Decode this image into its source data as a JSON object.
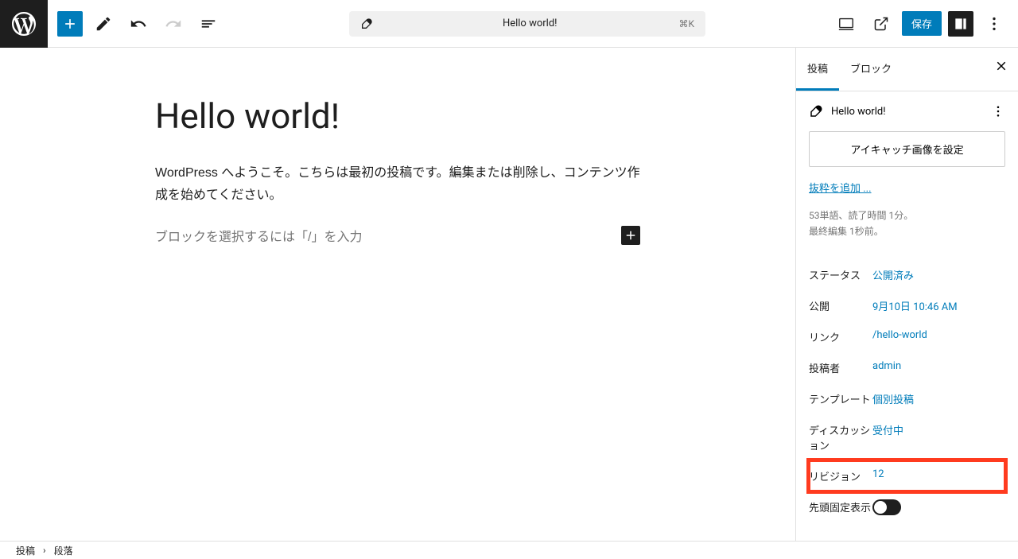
{
  "header": {
    "doc_title": "Hello world!",
    "shortcut": "⌘K",
    "save": "保存"
  },
  "editor": {
    "title": "Hello world!",
    "body": "WordPress へようこそ。こちらは最初の投稿です。編集または削除し、コンテンツ作成を始めてください。",
    "placeholder": "ブロックを選択するには「/」を入力"
  },
  "sidebar": {
    "tabs": {
      "post": "投稿",
      "block": "ブロック"
    },
    "post_name": "Hello world!",
    "featured_image": "アイキャッチ画像を設定",
    "excerpt_link": "抜粋を追加 ...",
    "stats_line1": "53単語、読了時間 1分。",
    "stats_line2": "最終編集 1秒前。",
    "meta": {
      "status_label": "ステータス",
      "status_value": "公開済み",
      "publish_label": "公開",
      "publish_value": "9月10日 10:46 AM",
      "link_label": "リンク",
      "link_value": "/hello-world",
      "author_label": "投稿者",
      "author_value": "admin",
      "template_label": "テンプレート",
      "template_value": "個別投稿",
      "discussion_label": "ディスカッション",
      "discussion_value": "受付中",
      "revision_label": "リビジョン",
      "revision_value": "12",
      "sticky_label": "先頭固定表示"
    }
  },
  "breadcrumb": {
    "root": "投稿",
    "sep": "›",
    "current": "段落"
  }
}
